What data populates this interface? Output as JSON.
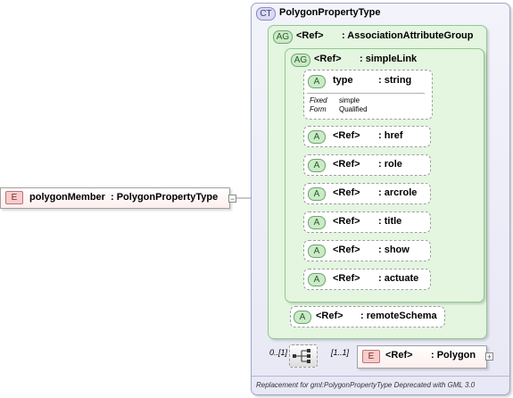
{
  "complex_type": {
    "badge": "CT",
    "name": "PolygonPropertyType"
  },
  "association_group": {
    "badge": "AG",
    "ref": "<Ref>",
    "name": ": AssociationAttributeGroup"
  },
  "simple_link": {
    "badge": "AG",
    "ref": "<Ref>",
    "name": ": simpleLink",
    "type_attr": {
      "badge": "A",
      "name": "type",
      "type": ": string",
      "fixed_label": "Fixed",
      "fixed_value": "simple",
      "form_label": "Form",
      "form_value": "Qualified"
    },
    "attributes": [
      {
        "badge": "A",
        "ref": "<Ref>",
        "name": ": href"
      },
      {
        "badge": "A",
        "ref": "<Ref>",
        "name": ": role"
      },
      {
        "badge": "A",
        "ref": "<Ref>",
        "name": ": arcrole"
      },
      {
        "badge": "A",
        "ref": "<Ref>",
        "name": ": title"
      },
      {
        "badge": "A",
        "ref": "<Ref>",
        "name": ": show"
      },
      {
        "badge": "A",
        "ref": "<Ref>",
        "name": ": actuate"
      }
    ]
  },
  "remote_schema": {
    "badge": "A",
    "ref": "<Ref>",
    "name": ": remoteSchema"
  },
  "root_element": {
    "badge": "E",
    "name": "polygonMember",
    "type": ": PolygonPropertyType"
  },
  "sequence": {
    "cardinality": "0..[1]"
  },
  "polygon": {
    "badge": "E",
    "ref": "<Ref>",
    "name": ": Polygon",
    "cardinality": "[1..1]"
  },
  "footer_note": "Replacement for gml:PolygonPropertyType Deprecated with GML 3.0"
}
